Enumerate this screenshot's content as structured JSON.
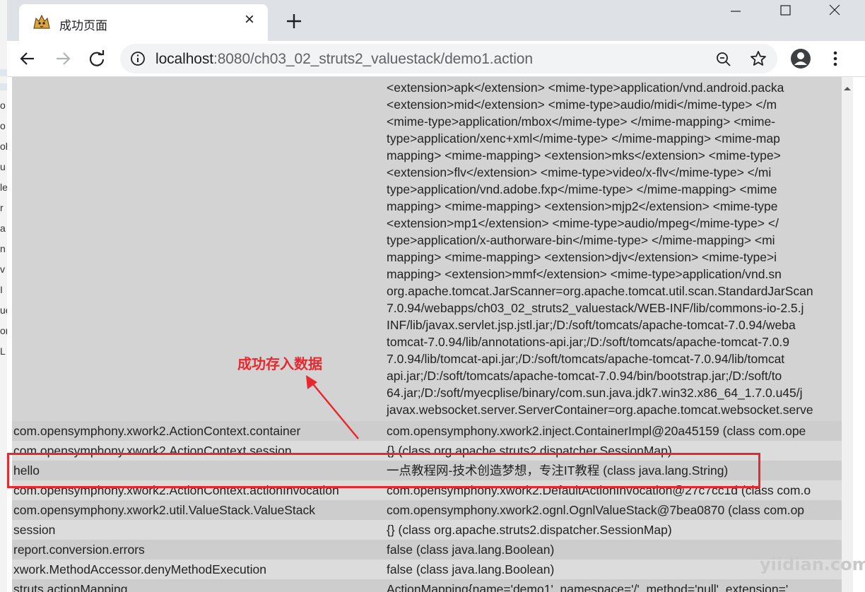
{
  "browser": {
    "tab_title": "成功页面",
    "url_host": "localhost",
    "url_path": ":8080/ch03_02_struts2_valuestack/demo1.action"
  },
  "icons": {
    "favicon": "tomcat-favicon-icon",
    "tab_close": "close-icon",
    "new_tab": "plus-icon",
    "back": "arrow-left-icon",
    "forward": "arrow-right-icon",
    "reload": "reload-icon",
    "site_info": "info-icon",
    "zoom": "zoom-icon",
    "bookmark": "star-icon",
    "profile": "account-icon",
    "menu": "kebab-menu-icon"
  },
  "big_value_lines": [
    "<extension>apk</extension> <mime-type>application/vnd.android.packa",
    "<extension>mid</extension> <mime-type>audio/midi</mime-type> </m",
    "<mime-type>application/mbox</mime-type> </mime-mapping> <mime-",
    "type>application/xenc+xml</mime-type> </mime-mapping> <mime-map",
    "mapping> <mime-mapping> <extension>mks</extension> <mime-type>",
    "<extension>flv</extension> <mime-type>video/x-flv</mime-type> </mi",
    "type>application/vnd.adobe.fxp</mime-type> </mime-mapping> <mime",
    "mapping> <mime-mapping> <extension>mjp2</extension> <mime-type",
    "<extension>mp1</extension> <mime-type>audio/mpeg</mime-type> </",
    "type>application/x-authorware-bin</mime-type> </mime-mapping> <mi",
    "mapping> <mime-mapping> <extension>djv</extension> <mime-type>i",
    "mapping> <extension>mmf</extension> <mime-type>application/vnd.sn",
    "org.apache.tomcat.JarScanner=org.apache.tomcat.util.scan.StandardJarScan",
    "7.0.94/webapps/ch03_02_struts2_valuestack/WEB-INF/lib/commons-io-2.5.j",
    "INF/lib/javax.servlet.jsp.jstl.jar;/D:/soft/tomcats/apache-tomcat-7.0.94/weba",
    "tomcat-7.0.94/lib/annotations-api.jar;/D:/soft/tomcats/apache-tomcat-7.0.9",
    "7.0.94/lib/tomcat-api.jar;/D:/soft/tomcats/apache-tomcat-7.0.94/lib/tomcat",
    "api.jar;/D:/soft/tomcats/apache-tomcat-7.0.94/bin/bootstrap.jar;/D:/soft/to",
    "64.jar;/D:/soft/myecplise/binary/com.sun.java.jdk7.win32.x86_64_1.7.0.u45/j",
    "javax.websocket.server.ServerContainer=org.apache.tomcat.websocket.serve"
  ],
  "rows": [
    {
      "key": "com.opensymphony.xwork2.ActionContext.container",
      "value": "com.opensymphony.xwork2.inject.ContainerImpl@20a45159 (class com.ope"
    },
    {
      "key": "com.opensymphony.xwork2.ActionContext.session",
      "value": "{} (class org.apache.struts2.dispatcher.SessionMap)"
    },
    {
      "key": "hello",
      "value": "一点教程网-技术创造梦想，专注IT教程 (class java.lang.String)"
    },
    {
      "key": "com.opensymphony.xwork2.ActionContext.actionInvocation",
      "value": "com.opensymphony.xwork2.DefaultActionInvocation@27c7cc1d (class com.o"
    },
    {
      "key": "com.opensymphony.xwork2.util.ValueStack.ValueStack",
      "value": "com.opensymphony.xwork2.ognl.OgnlValueStack@7bea0870 (class com.op"
    },
    {
      "key": "session",
      "value": "{} (class org.apache.struts2.dispatcher.SessionMap)"
    },
    {
      "key": "report.conversion.errors",
      "value": "false (class java.lang.Boolean)"
    },
    {
      "key": "xwork.MethodAccessor.denyMethodExecution",
      "value": "false (class java.lang.Boolean)"
    },
    {
      "key": "struts.actionMapping",
      "value": "ActionMapping{name='demo1', namespace='/', method='null', extension='"
    }
  ],
  "annotation": "成功存入数据",
  "watermark": "yiidian.com",
  "behind_window_chars": [
    "o",
    "o",
    "ok",
    "u",
    "le",
    "r",
    "a",
    "n",
    "v",
    "I",
    "ue",
    "or",
    "L"
  ],
  "colors": {
    "highlight": "#e8282c"
  }
}
